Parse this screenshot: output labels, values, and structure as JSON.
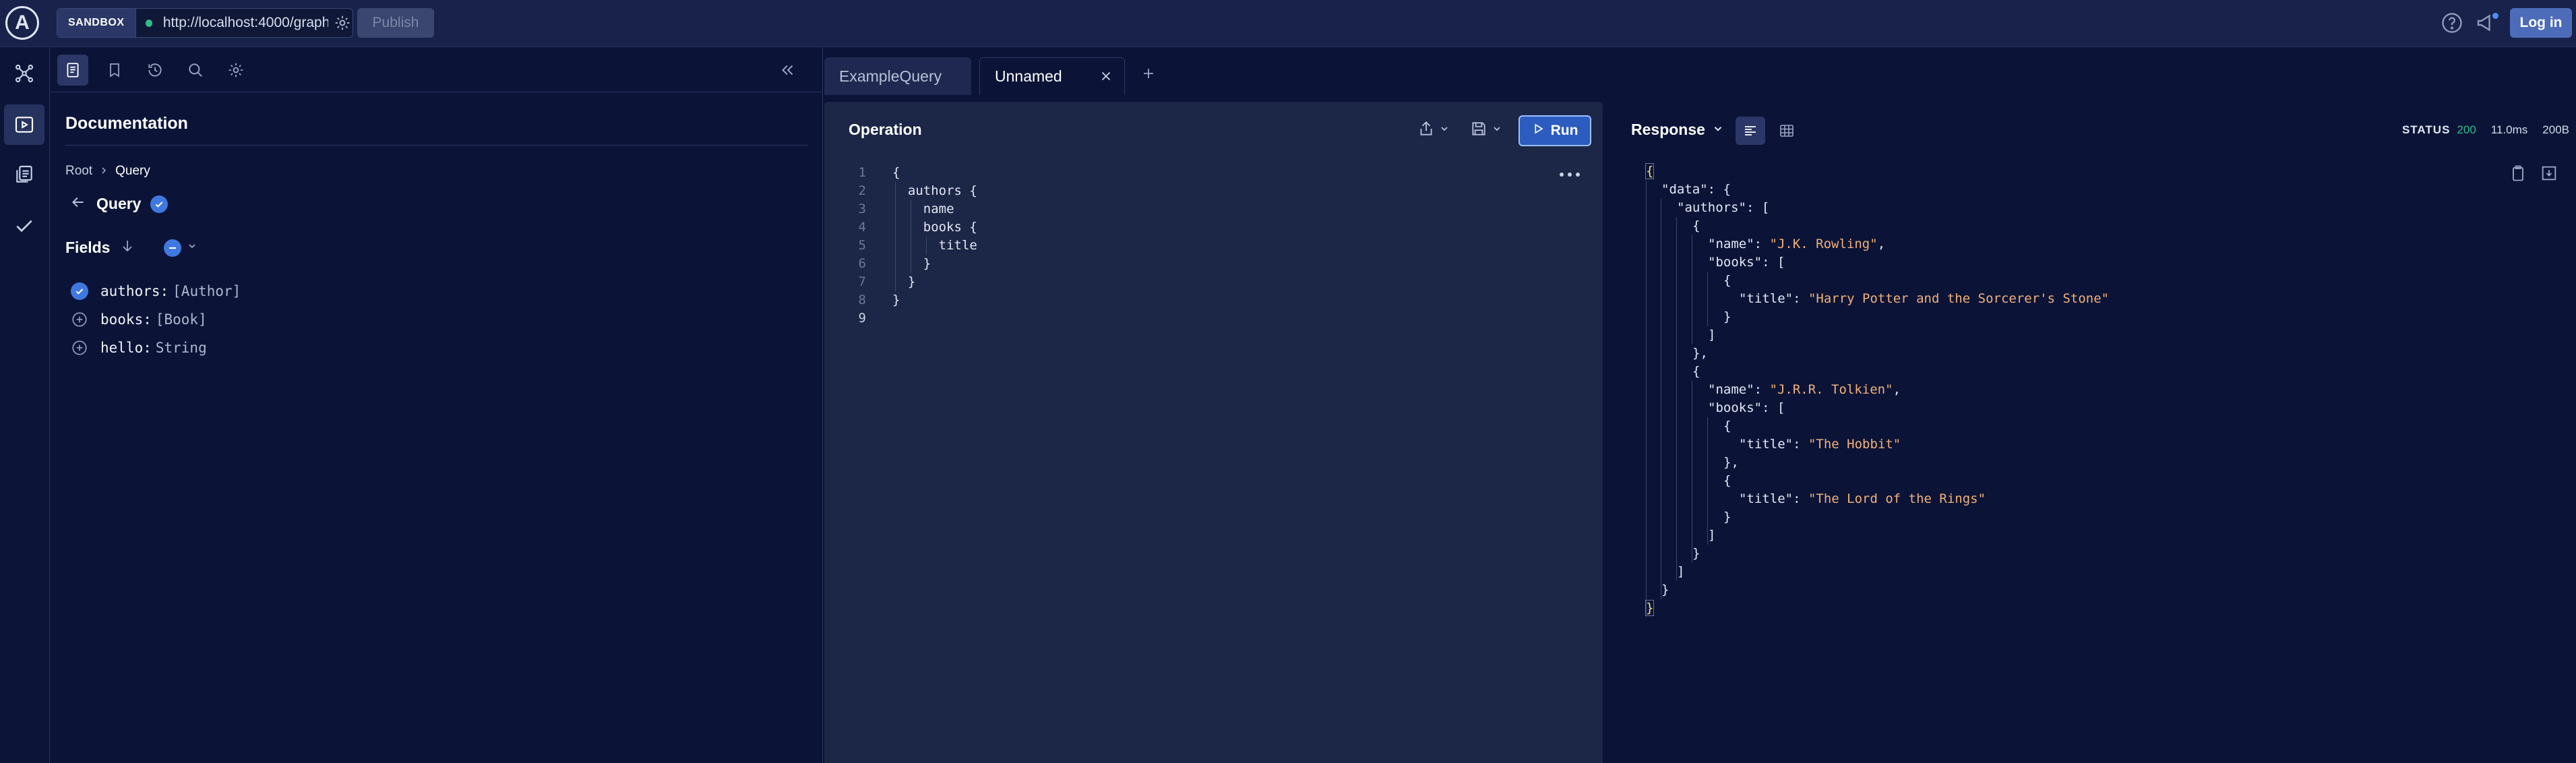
{
  "topbar": {
    "logo_letter": "A",
    "sandbox_label": "SANDBOX",
    "url": "http://localhost:4000/graphql",
    "publish_label": "Publish",
    "login_label": "Log in"
  },
  "rail": {
    "items": [
      "schema-icon",
      "explorer-icon",
      "operation-collections-icon",
      "checks-icon"
    ]
  },
  "docs": {
    "title": "Documentation",
    "breadcrumb": [
      "Root",
      "Query"
    ],
    "query_title": "Query",
    "fields_title": "Fields",
    "fields": [
      {
        "name": "authors:",
        "type": "[Author]",
        "selected": true
      },
      {
        "name": "books:",
        "type": "[Book]",
        "selected": false
      },
      {
        "name": "hello:",
        "type": "String",
        "selected": false
      }
    ]
  },
  "tabs": [
    {
      "label": "ExampleQuery"
    },
    {
      "label": "Unnamed"
    }
  ],
  "operation": {
    "title": "Operation",
    "run_label": "Run",
    "lines": [
      {
        "n": "1",
        "code": "{"
      },
      {
        "n": "2",
        "code": "  authors {"
      },
      {
        "n": "3",
        "code": "    name"
      },
      {
        "n": "4",
        "code": "    books {"
      },
      {
        "n": "5",
        "code": "      title"
      },
      {
        "n": "6",
        "code": "    }"
      },
      {
        "n": "7",
        "code": "  }"
      },
      {
        "n": "8",
        "code": "}"
      },
      {
        "n": "9",
        "code": ""
      }
    ]
  },
  "response": {
    "title": "Response",
    "status_label": "STATUS",
    "status_code": "200",
    "time": "11.0ms",
    "size": "200B",
    "lines": [
      {
        "indent": 0,
        "key": "",
        "text": "{"
      },
      {
        "indent": 1,
        "key": "\"data\"",
        "text": ": {"
      },
      {
        "indent": 2,
        "key": "\"authors\"",
        "text": ": ["
      },
      {
        "indent": 3,
        "key": "",
        "text": "{"
      },
      {
        "indent": 4,
        "key": "\"name\"",
        "text": ": ",
        "str": "\"J.K. Rowling\"",
        "tail": ","
      },
      {
        "indent": 4,
        "key": "\"books\"",
        "text": ": ["
      },
      {
        "indent": 5,
        "key": "",
        "text": "{"
      },
      {
        "indent": 6,
        "key": "\"title\"",
        "text": ": ",
        "str": "\"Harry Potter and the Sorcerer's Stone\""
      },
      {
        "indent": 5,
        "key": "",
        "text": "}"
      },
      {
        "indent": 4,
        "key": "",
        "text": "]"
      },
      {
        "indent": 3,
        "key": "",
        "text": "},"
      },
      {
        "indent": 3,
        "key": "",
        "text": "{"
      },
      {
        "indent": 4,
        "key": "\"name\"",
        "text": ": ",
        "str": "\"J.R.R. Tolkien\"",
        "tail": ","
      },
      {
        "indent": 4,
        "key": "\"books\"",
        "text": ": ["
      },
      {
        "indent": 5,
        "key": "",
        "text": "{"
      },
      {
        "indent": 6,
        "key": "\"title\"",
        "text": ": ",
        "str": "\"The Hobbit\""
      },
      {
        "indent": 5,
        "key": "",
        "text": "},"
      },
      {
        "indent": 5,
        "key": "",
        "text": "{"
      },
      {
        "indent": 6,
        "key": "\"title\"",
        "text": ": ",
        "str": "\"The Lord of the Rings\""
      },
      {
        "indent": 5,
        "key": "",
        "text": "}"
      },
      {
        "indent": 4,
        "key": "",
        "text": "]"
      },
      {
        "indent": 3,
        "key": "",
        "text": "}"
      },
      {
        "indent": 2,
        "key": "",
        "text": "]"
      },
      {
        "indent": 1,
        "key": "",
        "text": "}"
      },
      {
        "indent": 0,
        "key": "",
        "text": "}"
      }
    ]
  },
  "colors": {
    "accent": "#3f79e0",
    "status_ok": "#2ebd8a",
    "string_value": "#f3b07a"
  }
}
